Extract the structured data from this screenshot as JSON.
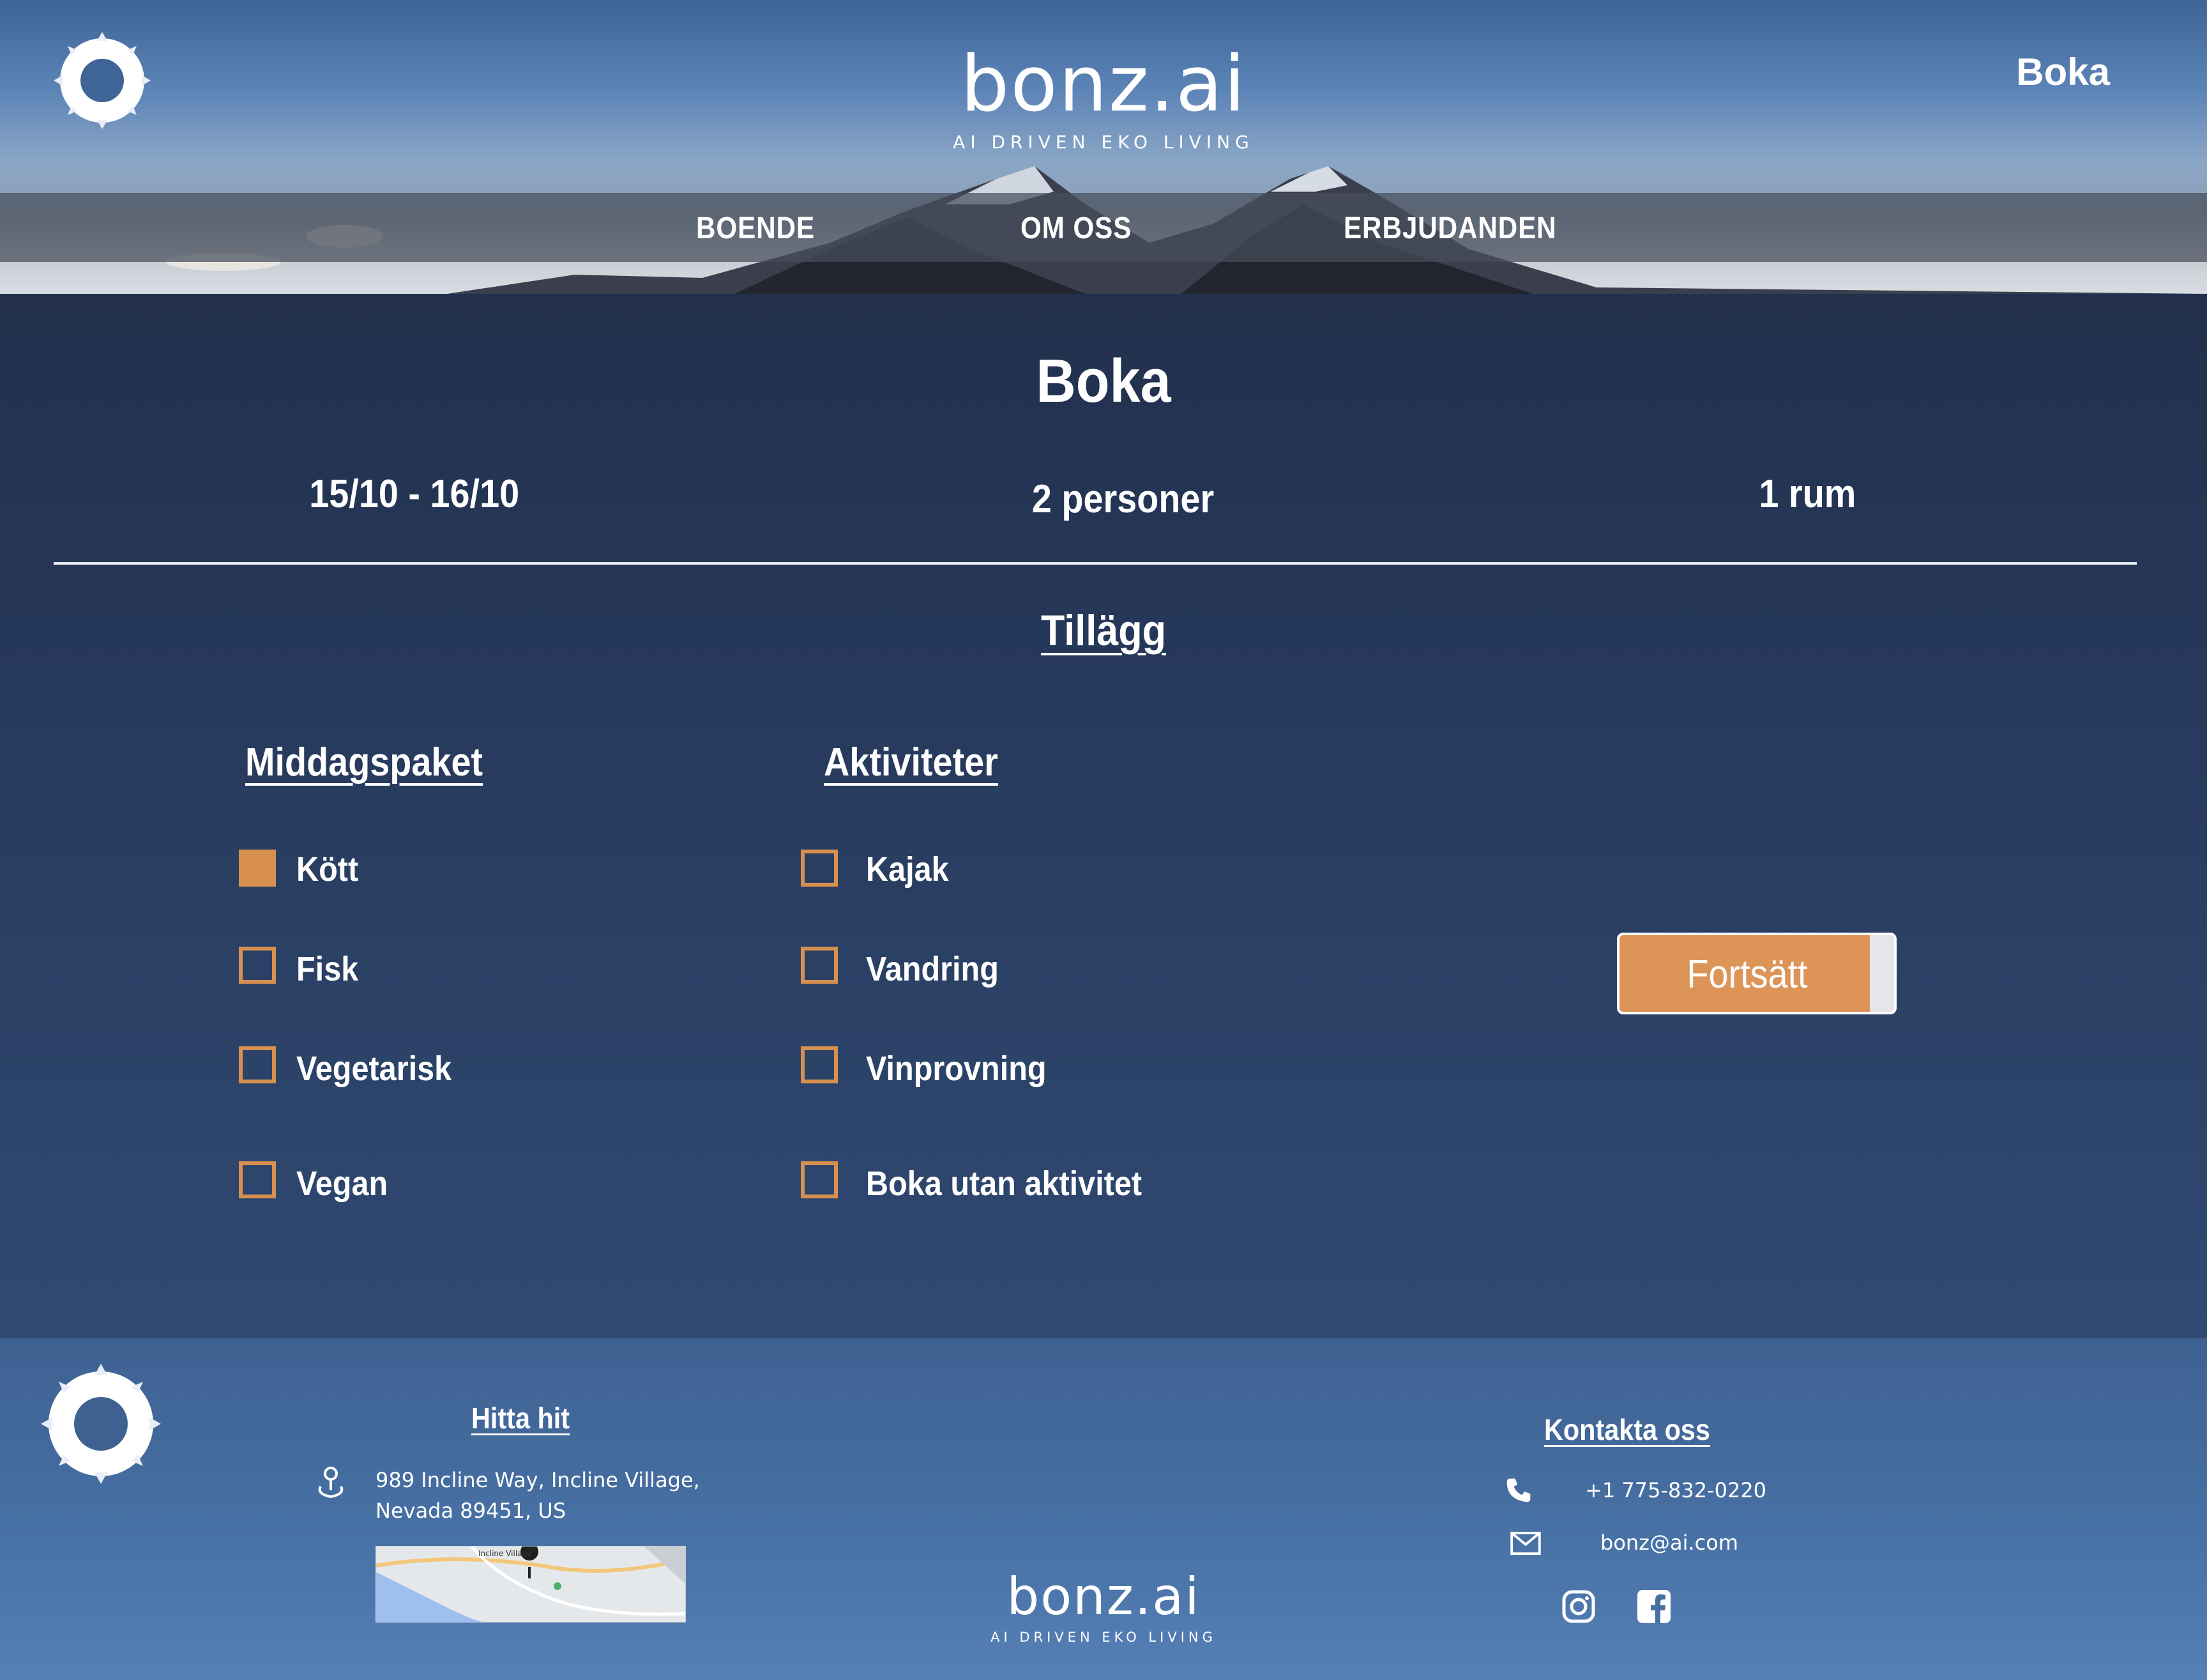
{
  "header": {
    "brand_name": "bonz.ai",
    "brand_tagline": "AI DRIVEN EKO LIVING",
    "book_link": "Boka",
    "nav": [
      "BOENDE",
      "OM OSS",
      "ERBJUDANDEN"
    ]
  },
  "main": {
    "title": "Boka",
    "summary": {
      "dates": "15/10 - 16/10",
      "guests": "2 personer",
      "rooms": "1 rum"
    },
    "section_title": "Tillägg",
    "dinner": {
      "title": "Middagspaket",
      "options": [
        {
          "label": "Kött",
          "checked": true
        },
        {
          "label": "Fisk",
          "checked": false
        },
        {
          "label": "Vegetarisk",
          "checked": false
        },
        {
          "label": "Vegan",
          "checked": false
        }
      ]
    },
    "activities": {
      "title": "Aktiviteter",
      "options": [
        {
          "label": "Kajak",
          "checked": false
        },
        {
          "label": "Vandring",
          "checked": false
        },
        {
          "label": "Vinprovning",
          "checked": false
        },
        {
          "label": "Boka utan aktivitet",
          "checked": false
        }
      ]
    },
    "continue_button": "Fortsätt"
  },
  "footer": {
    "find_us": {
      "title": "Hitta hit",
      "address_line1": "989 Incline Way, Incline Village,",
      "address_line2": "Nevada 89451, US",
      "map_place": "Incline Village"
    },
    "contact": {
      "title": "Kontakta oss",
      "phone": "+1 775-832-0220",
      "email": "bonz@ai.com"
    },
    "brand_name": "bonz.ai",
    "brand_tagline": "AI DRIVEN EKO LIVING"
  },
  "colors": {
    "accent": "#d8904f",
    "main_bg": "#22304d",
    "footer_bg": "#4770a4",
    "navbar": "#464e5a"
  },
  "icons": [
    "sun-logo-icon",
    "location-pin-icon",
    "phone-icon",
    "mail-icon",
    "instagram-icon",
    "facebook-icon"
  ]
}
